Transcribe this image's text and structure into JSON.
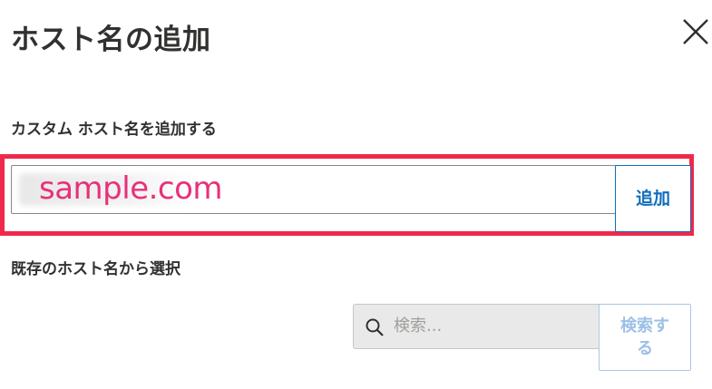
{
  "dialog": {
    "title": "ホスト名の追加",
    "close_icon": "close-icon"
  },
  "custom_hostname": {
    "label": "カスタム ホスト名を追加する",
    "input_value": "sample.com",
    "add_button_label": "追加"
  },
  "existing_hostname": {
    "label": "既存のホスト名から選択",
    "search_placeholder": "検索...",
    "search_icon": "search-icon",
    "search_button_label": "検索する"
  },
  "colors": {
    "highlight_border": "#f0284a",
    "input_value_text": "#e8307a",
    "primary_button": "#0f6cbd",
    "disabled_button": "#9cc0e8"
  }
}
